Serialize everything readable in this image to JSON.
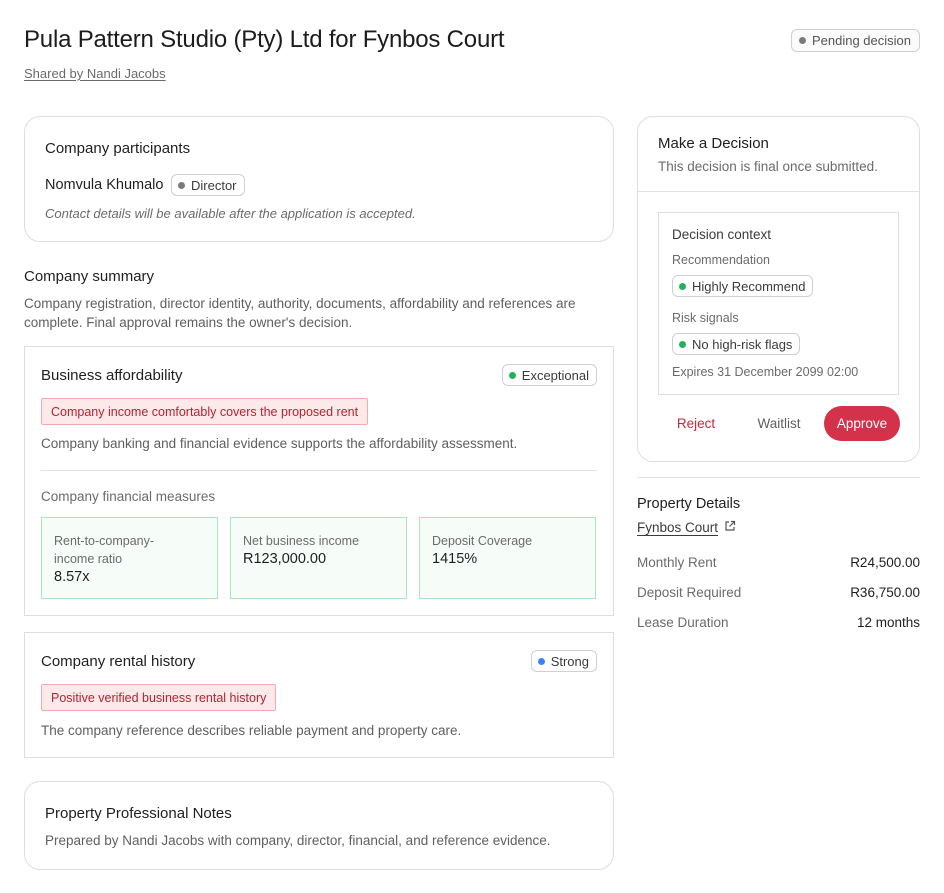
{
  "header": {
    "title": "Pula Pattern Studio (Pty) Ltd for Fynbos Court",
    "shared_by": "Shared by Nandi Jacobs",
    "status": "Pending decision"
  },
  "participants": {
    "title": "Company participants",
    "name": "Nomvula Khumalo",
    "role": "Director",
    "contact_note": "Contact details will be available after the application is accepted."
  },
  "summary": {
    "title": "Company summary",
    "text": "Company registration, director identity, authority, documents, affordability and references are complete. Final approval remains the owner's decision."
  },
  "affordability": {
    "title": "Business affordability",
    "rating": "Exceptional",
    "alert": "Company income comfortably covers the proposed rent",
    "description": "Company banking and financial evidence supports the affordability assessment.",
    "measures_title": "Company financial measures",
    "metrics": [
      {
        "label": "Rent-to-company-income ratio",
        "value": "8.57x"
      },
      {
        "label": "Net business income",
        "value": "R123,000.00"
      },
      {
        "label": "Deposit Coverage",
        "value": "1415%"
      }
    ]
  },
  "rental_history": {
    "title": "Company rental history",
    "rating": "Strong",
    "alert": "Positive verified business rental history",
    "description": "The company reference describes reliable payment and property care."
  },
  "notes": {
    "title": "Property Professional Notes",
    "text": "Prepared by Nandi Jacobs with company, director, financial, and reference evidence."
  },
  "decision": {
    "title": "Make a Decision",
    "subtitle": "This decision is final once submitted.",
    "context_title": "Decision context",
    "recommendation_label": "Recommendation",
    "recommendation": "Highly Recommend",
    "risk_label": "Risk signals",
    "risk": "No high-risk flags",
    "expires": "Expires 31 December 2099 02:00",
    "reject_label": "Reject",
    "waitlist_label": "Waitlist",
    "approve_label": "Approve"
  },
  "property": {
    "title": "Property Details",
    "link": "Fynbos Court",
    "rows": [
      {
        "key": "Monthly Rent",
        "value": "R24,500.00"
      },
      {
        "key": "Deposit Required",
        "value": "R36,750.00"
      },
      {
        "key": "Lease Duration",
        "value": "12 months"
      }
    ]
  },
  "colors": {
    "accent": "#d4314b",
    "positive": "#22b25a",
    "info": "#3b82f6",
    "alert_bg": "#fde8ea",
    "metric_border": "#a9e6bd"
  },
  "icons": {
    "external_link": "external-link-icon",
    "status_dot": "dot-icon"
  }
}
